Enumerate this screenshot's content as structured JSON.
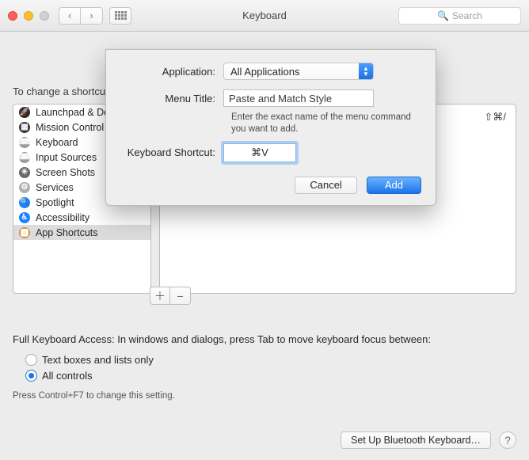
{
  "window": {
    "title": "Keyboard",
    "search_placeholder": "Search"
  },
  "main": {
    "intro": "To change a shortcut, select it, double-click the key combination, then type the new keys.",
    "categories": [
      {
        "label": "Launchpad & Dock",
        "icon": "🚀",
        "bg": "#2b2b2b"
      },
      {
        "label": "Mission Control",
        "icon": "▦",
        "bg": "#3a3a3a"
      },
      {
        "label": "Keyboard",
        "icon": "⌨︎",
        "bg": "#9a9a9a"
      },
      {
        "label": "Input Sources",
        "icon": "⌨︎",
        "bg": "#9a9a9a"
      },
      {
        "label": "Screen Shots",
        "icon": "✳︎",
        "bg": "#696969"
      },
      {
        "label": "Services",
        "icon": "⚙︎",
        "bg": "#b0b0b0"
      },
      {
        "label": "Spotlight",
        "icon": "🔍",
        "bg": "#1a83ff"
      },
      {
        "label": "Accessibility",
        "icon": "♿︎",
        "bg": "#1a83ff"
      },
      {
        "label": "App Shortcuts",
        "icon": "🅰︎",
        "bg": "#d6913d"
      }
    ],
    "selected_index": 8,
    "right_shortcut_display": "⇧⌘/",
    "full_access": {
      "text": "Full Keyboard Access: In windows and dialogs, press Tab to move keyboard focus between:",
      "options": [
        "Text boxes and lists only",
        "All controls"
      ],
      "selected": 1,
      "hint": "Press Control+F7 to change this setting."
    },
    "bluetooth_button": "Set Up Bluetooth Keyboard…"
  },
  "sheet": {
    "application_label": "Application:",
    "application_value": "All Applications",
    "menu_title_label": "Menu Title:",
    "menu_title_value": "Paste and Match Style",
    "menu_title_help": "Enter the exact name of the menu command you want to add.",
    "shortcut_label": "Keyboard Shortcut:",
    "shortcut_value": "⌘V",
    "cancel": "Cancel",
    "add": "Add"
  }
}
